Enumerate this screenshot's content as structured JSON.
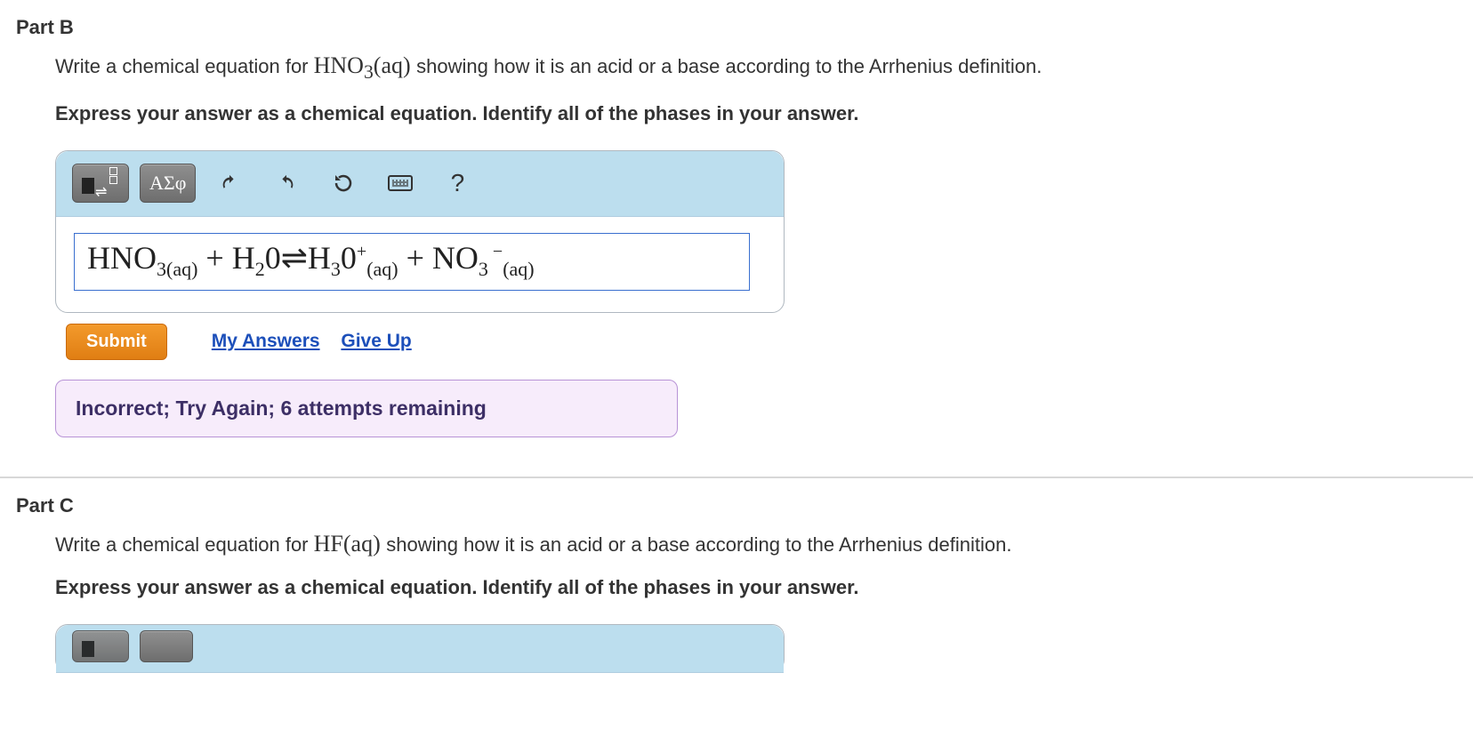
{
  "partB": {
    "header": "Part B",
    "prompt_pre": "Write a chemical equation for ",
    "prompt_formula": "HNO",
    "prompt_formula_sub": "3",
    "prompt_formula_phase": "(aq)",
    "prompt_post": " showing how it is an acid or a base according to the Arrhenius definition.",
    "instruction": "Express your answer as a chemical equation. Identify all of the phases in your answer.",
    "toolbar": {
      "greek_label": "ΑΣφ",
      "help_label": "?"
    },
    "equation_html": "HNO<sub>3(aq)</sub> + H<sub>2</sub>0⇌H<sub>3</sub>0<sup>+</sup><sub class=\"phase\">(aq)</sub> + NO<sub>3</sub><sup>&nbsp;&minus;</sup><sub class=\"phase\">(aq)</sub>",
    "submit_label": "Submit",
    "myanswers_label": "My Answers",
    "giveup_label": "Give Up",
    "feedback": "Incorrect; Try Again; 6 attempts remaining"
  },
  "partC": {
    "header": "Part C",
    "prompt_pre": "Write a chemical equation for ",
    "prompt_formula": "HF",
    "prompt_formula_phase": "(aq)",
    "prompt_post": " showing how it is an acid or a base according to the Arrhenius definition.",
    "instruction": "Express your answer as a chemical equation. Identify all of the phases in your answer."
  }
}
